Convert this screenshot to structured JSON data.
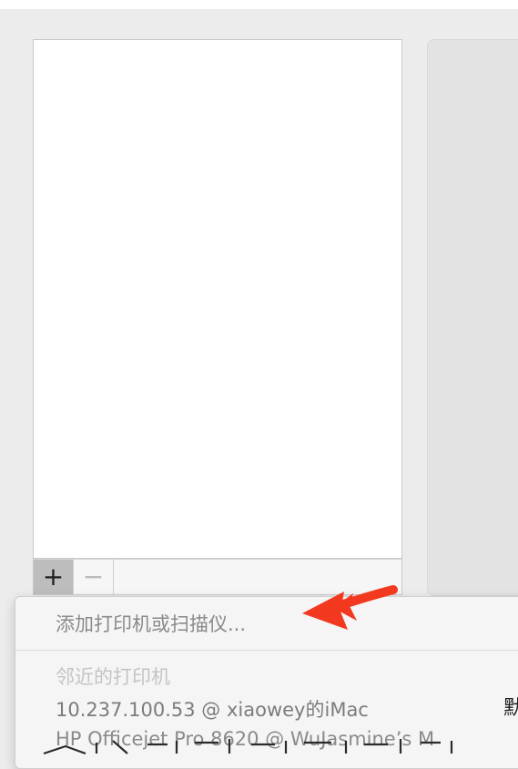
{
  "list_controls": {
    "add_label": "+",
    "remove_label": "−"
  },
  "menu": {
    "add_printer_label": "添加打印机或扫描仪...",
    "nearby_header": "邻近的打印机",
    "printers": [
      {
        "label": "10.237.100.53 @ xiaowey的iMac"
      },
      {
        "label": "HP Officejet Pro 8620 @ WuJasmine’s M"
      }
    ],
    "right_column_char": "默"
  },
  "annotation": {
    "arrow_color": "#f2391f",
    "arrow_icon": "red-pointer-arrow-icon"
  }
}
